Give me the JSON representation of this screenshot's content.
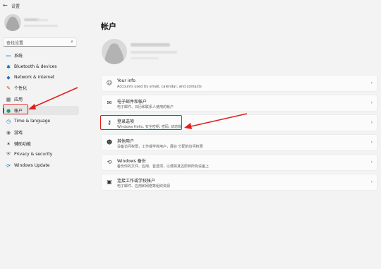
{
  "titlebar": {
    "back": "←",
    "title": "设置"
  },
  "search": {
    "placeholder": "查找设置",
    "icon": "search-icon"
  },
  "sidebar": {
    "items": [
      {
        "label": "系统",
        "icon": "monitor-icon",
        "glyph": "▭",
        "color": "#0078d4"
      },
      {
        "label": "Bluetooth & devices",
        "icon": "bluetooth-icon",
        "glyph": "✱",
        "color": "#0063b1"
      },
      {
        "label": "Network & internet",
        "icon": "wifi-icon",
        "glyph": "◆",
        "color": "#2b6cb0"
      },
      {
        "label": "个性化",
        "icon": "brush-icon",
        "glyph": "✎",
        "color": "#c04b1a"
      },
      {
        "label": "应用",
        "icon": "apps-icon",
        "glyph": "▦",
        "color": "#555555"
      },
      {
        "label": "帐户",
        "icon": "person-icon",
        "glyph": "●",
        "color": "#1aa06d"
      },
      {
        "label": "Time & language",
        "icon": "clock-globe-icon",
        "glyph": "◷",
        "color": "#1a73c9"
      },
      {
        "label": "游戏",
        "icon": "gamepad-icon",
        "glyph": "◉",
        "color": "#6b6b6b"
      },
      {
        "label": "辅助功能",
        "icon": "accessibility-icon",
        "glyph": "✶",
        "color": "#1f4e9c"
      },
      {
        "label": "Privacy & security",
        "icon": "shield-icon",
        "glyph": "⛨",
        "color": "#6b6b6b"
      },
      {
        "label": "Windows Update",
        "icon": "update-icon",
        "glyph": "⟳",
        "color": "#0078d4"
      }
    ]
  },
  "main": {
    "title": "帐户",
    "rows": [
      {
        "title": "Your info",
        "subtitle": "Accounts used by email, calendar, and contacts",
        "icon": "person-outline-icon",
        "glyph": "☺"
      },
      {
        "title": "电子邮件和帐户",
        "subtitle": "电子邮件、日历和联系人使用的帐户",
        "icon": "mail-icon",
        "glyph": "✉"
      },
      {
        "title": "登录选项",
        "subtitle": "Windows Hello, 安全密钥, 密码, 动态锁",
        "icon": "key-icon",
        "glyph": "⚷"
      },
      {
        "title": "其他用户",
        "subtitle": "设备访问权限，工作或学校用户，展台 分配的访问权限",
        "icon": "people-add-icon",
        "glyph": "☻"
      },
      {
        "title": "Windows 备份",
        "subtitle": "备份你的文件、应用、首选项，以便将其还原到所有设备上",
        "icon": "backup-icon",
        "glyph": "⟲"
      },
      {
        "title": "连接工作或学校帐户",
        "subtitle": "电子邮件、应用和网络等组织资源",
        "icon": "briefcase-icon",
        "glyph": "▣"
      }
    ],
    "chevron": "›"
  },
  "colors": {
    "accent": "#005fb8",
    "annotation_red": "#e0201c"
  }
}
